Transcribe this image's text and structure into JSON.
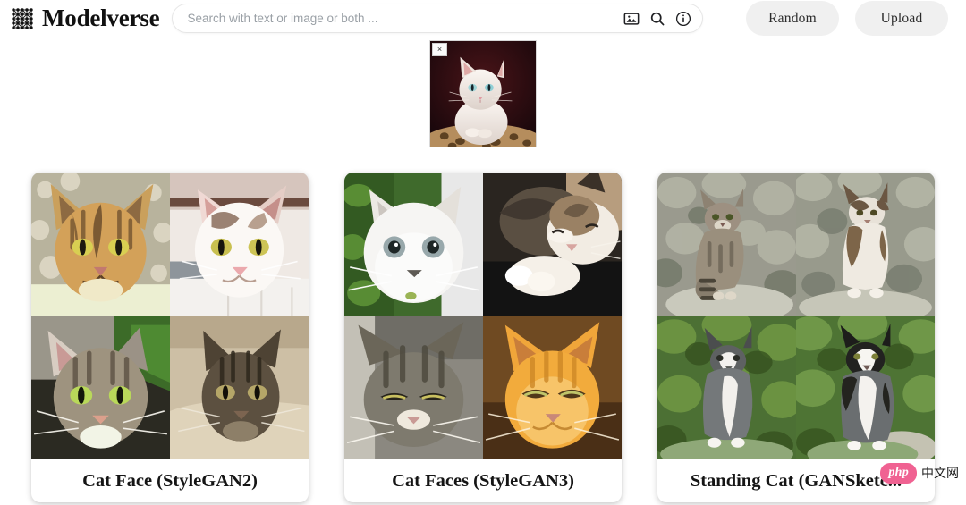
{
  "header": {
    "brand_name": "Modelverse",
    "logo_icon": "neural-network-grid-icon",
    "search": {
      "placeholder": "Search with text or image or both ...",
      "value": "",
      "icons": [
        {
          "name": "image-search-icon",
          "label": "image"
        },
        {
          "name": "search-icon",
          "label": "search"
        },
        {
          "name": "info-icon",
          "label": "info"
        }
      ]
    },
    "buttons": [
      {
        "name": "random-button",
        "label": "Random"
      },
      {
        "name": "upload-button",
        "label": "Upload"
      }
    ]
  },
  "query_thumbnail": {
    "alt": "white cat sitting in leopard print bed",
    "close_label": "×"
  },
  "results": {
    "cards": [
      {
        "title": "Cat Face (StyleGAN2)",
        "images": [
          "tabby cat face closeup",
          "white and tan cat face",
          "grey tabby cat face",
          "dark brown tabby cat face"
        ]
      },
      {
        "title": "Cat Faces (StyleGAN3)",
        "images": [
          "white fluffy kitten face",
          "calico cat curled up sleeping",
          "grey tabby cat squinting",
          "orange ginger cat face"
        ]
      },
      {
        "title": "Standing Cat (GANSketc...",
        "images": [
          "brown tabby cat sitting on rock",
          "brown and white cat sitting",
          "grey and white cat sitting on grass",
          "black and white tuxedo cat sitting"
        ]
      }
    ]
  },
  "watermark": {
    "logo_text": "php",
    "text": "中文网"
  },
  "colors": {
    "page_bg": "#ffffff",
    "button_bg": "#f0f0f0",
    "text": "#151515",
    "placeholder": "#9aa0a6",
    "watermark_pink": "#f06292"
  }
}
